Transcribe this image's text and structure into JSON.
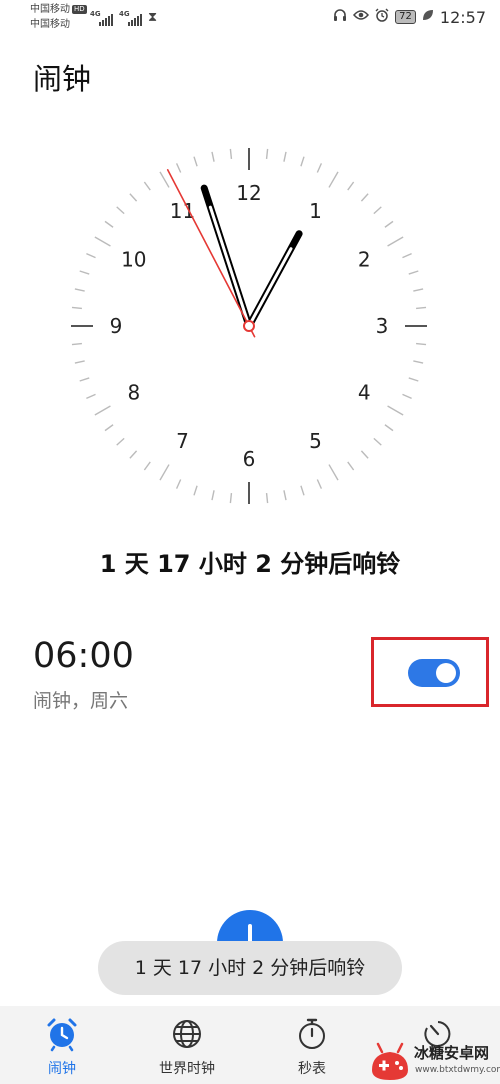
{
  "status_bar": {
    "carrier_1": "中国移动",
    "hd_badge": "HD",
    "carrier_2": "中国移动",
    "network_1": "4G",
    "network_2": "4G",
    "battery_level": "72",
    "time": "12:57"
  },
  "page": {
    "title": "闹钟"
  },
  "clock": {
    "numerals": [
      "12",
      "1",
      "2",
      "3",
      "4",
      "5",
      "6",
      "7",
      "8",
      "9",
      "10",
      "11"
    ],
    "displayed_time": "12:57",
    "hand_color": "#000000",
    "second_hand_color": "#e53935"
  },
  "countdown": {
    "text": "1 天 17 小时 2 分钟后响铃"
  },
  "alarm": {
    "time": "06:00",
    "description": "闹钟，周六",
    "enabled": true,
    "toggle_color": "#2d78e6"
  },
  "fab": {
    "icon": "plus-icon"
  },
  "toast": {
    "text": "1 天 17 小时 2 分钟后响铃"
  },
  "bottom_nav": {
    "items": [
      {
        "label": "闹钟",
        "icon": "alarm-clock-icon",
        "active": true
      },
      {
        "label": "世界时钟",
        "icon": "globe-icon",
        "active": false
      },
      {
        "label": "秒表",
        "icon": "stopwatch-icon",
        "active": false
      },
      {
        "label": "",
        "icon": "timer-icon",
        "active": false
      }
    ],
    "active_color": "#2074e8"
  },
  "watermark": {
    "title": "冰糖安卓网",
    "url": "www.btxtdwmy.com"
  }
}
